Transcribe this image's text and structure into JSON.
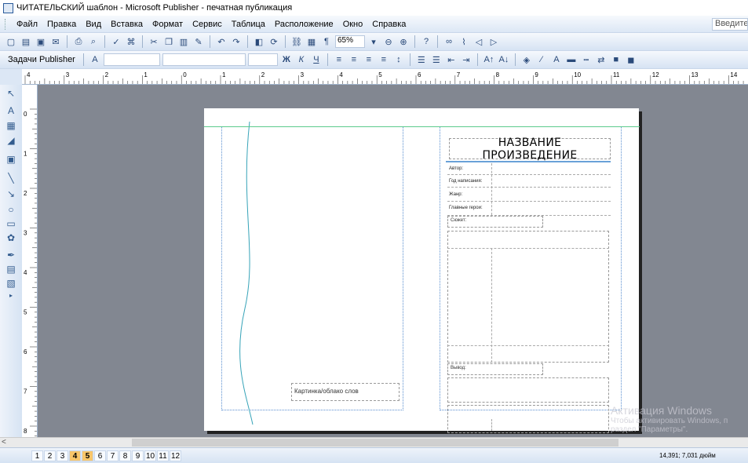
{
  "title": "ЧИТАТЕЛЬСКИЙ шаблон - Microsoft Publisher - печатная публикация",
  "menu": [
    "Файл",
    "Правка",
    "Вид",
    "Вставка",
    "Формат",
    "Сервис",
    "Таблица",
    "Расположение",
    "Окно",
    "Справка"
  ],
  "search_placeholder": "Введите",
  "zoom": "65%",
  "tasks_label": "Задачи Publisher",
  "ruler_labels": [
    "4",
    "3",
    "2",
    "1",
    "0",
    "1",
    "2",
    "3",
    "4",
    "5",
    "6",
    "7",
    "8",
    "9",
    "10",
    "11",
    "12",
    "13",
    "14"
  ],
  "vruler_labels": [
    "0",
    "1",
    "2",
    "3",
    "4",
    "5",
    "6",
    "7",
    "8"
  ],
  "left_page": {
    "caption": "Картинка/облако слов"
  },
  "right_page": {
    "title": "НАЗВАНИЕ ПРОИЗВЕДЕНИЕ",
    "fields": [
      "Автор:",
      "Год написания:",
      "Жанр:",
      "Главные герои:"
    ],
    "plot_label": "Сюжет:",
    "conclusion_label": "Вывод:"
  },
  "page_tabs": [
    "1",
    "2",
    "3",
    "4",
    "5",
    "6",
    "7",
    "8",
    "9",
    "10",
    "11",
    "12"
  ],
  "active_pages": [
    "4",
    "5"
  ],
  "coords": "14,391; 7,031 дюйм",
  "watermark": {
    "line1": "Активация Windows",
    "line2": "Чтобы активировать Windows, п",
    "line3": "раздел \"Параметры\"."
  }
}
